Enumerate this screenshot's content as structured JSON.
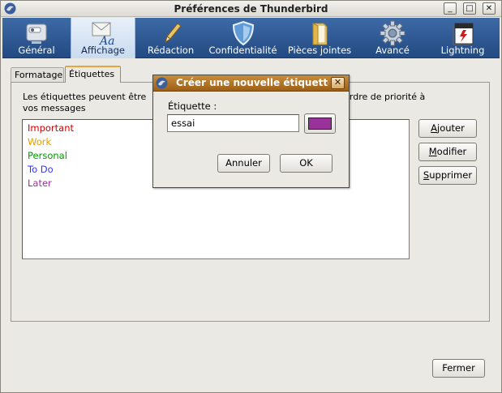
{
  "window": {
    "title": "Préférences de Thunderbird",
    "controls": [
      "_",
      "□",
      "✕"
    ]
  },
  "toolbar": {
    "items": [
      {
        "label": "Général",
        "icon": "monitor-switch-icon",
        "selected": false
      },
      {
        "label": "Affichage",
        "icon": "display-font-icon",
        "selected": true
      },
      {
        "label": "Rédaction",
        "icon": "pencil-icon",
        "selected": false
      },
      {
        "label": "Confidentialité",
        "icon": "shield-icon",
        "selected": false
      },
      {
        "label": "Pièces jointes",
        "icon": "folder-icon",
        "selected": false
      },
      {
        "label": "Avancé",
        "icon": "gear-icon",
        "selected": false
      },
      {
        "label": "Lightning",
        "icon": "calendar-icon",
        "selected": false
      }
    ]
  },
  "tabs": [
    {
      "label": "Formatage",
      "active": false
    },
    {
      "label": "Étiquettes",
      "active": true
    }
  ],
  "tags_panel": {
    "description_left": "Les étiquettes peuvent être",
    "description_right": "her un ordre de priorité à",
    "description_line2": "vos messages",
    "tags": [
      {
        "label": "Important",
        "color": "#cc0000"
      },
      {
        "label": "Work",
        "color": "#e89b00"
      },
      {
        "label": "Personal",
        "color": "#009900"
      },
      {
        "label": "To Do",
        "color": "#3333ff"
      },
      {
        "label": "Later",
        "color": "#993399"
      }
    ],
    "buttons": {
      "add": {
        "underlined": "A",
        "rest": "jouter"
      },
      "modify": {
        "underlined": "M",
        "rest": "odifier"
      },
      "delete": {
        "underlined": "S",
        "rest": "upprimer"
      }
    }
  },
  "footer": {
    "close_label": "Fermer"
  },
  "dialog": {
    "title": "Créer une nouvelle étiquette",
    "close_glyph": "✕",
    "field_label": "Étiquette :",
    "field_value": "essai",
    "selected_color": "#993399",
    "cancel_label": "Annuler",
    "ok_label": "OK"
  }
}
